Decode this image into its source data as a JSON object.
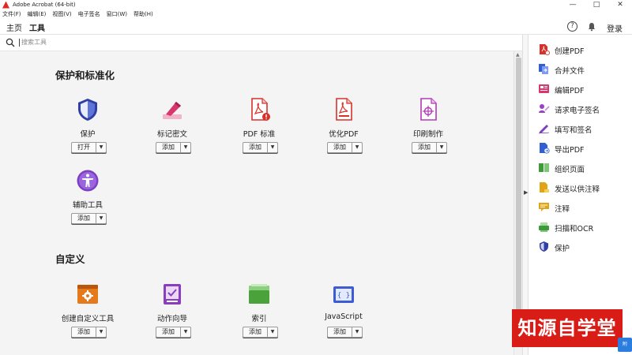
{
  "window": {
    "title": "Adobe Acrobat (64-bit)",
    "controls": [
      "—",
      "□",
      "✕"
    ]
  },
  "menu": [
    "文件(F)",
    "编辑(E)",
    "视图(V)",
    "电子签名",
    "窗口(W)",
    "帮助(H)"
  ],
  "topbar": {
    "tabs": [
      "主页",
      "工具"
    ],
    "active_tab": "工具",
    "help_icon": "?",
    "login": "登录"
  },
  "search": {
    "placeholder": "搜索工具"
  },
  "sections": [
    {
      "title": "保护和标准化",
      "tools": [
        {
          "label": "保护",
          "button": "打开",
          "icon": "shield-icon",
          "color": "#2f3fa3"
        },
        {
          "label": "标记密文",
          "button": "添加",
          "icon": "redact-icon",
          "color": "#d6386e"
        },
        {
          "label": "PDF 标准",
          "button": "添加",
          "icon": "pdf-standard-icon",
          "color": "#d9302a"
        },
        {
          "label": "优化PDF",
          "button": "添加",
          "icon": "optimize-pdf-icon",
          "color": "#d9302a"
        },
        {
          "label": "印刷制作",
          "button": "添加",
          "icon": "print-production-icon",
          "color": "#b23ab5"
        },
        {
          "label": "辅助工具",
          "button": "添加",
          "icon": "accessibility-icon",
          "color": "#7b3fc4"
        }
      ]
    },
    {
      "title": "自定义",
      "tools": [
        {
          "label": "创建自定义工具",
          "button": "添加",
          "icon": "custom-tool-icon",
          "color": "#e57a1c"
        },
        {
          "label": "动作向导",
          "button": "添加",
          "icon": "action-wizard-icon",
          "color": "#8a3ebf"
        },
        {
          "label": "索引",
          "button": "添加",
          "icon": "index-icon",
          "color": "#4aa33a"
        },
        {
          "label": "JavaScript",
          "button": "添加",
          "icon": "javascript-icon",
          "color": "#3d5bd6"
        }
      ]
    }
  ],
  "right_panel": [
    {
      "label": "创建PDF",
      "icon": "create-pdf-icon",
      "color": "#d9302a"
    },
    {
      "label": "合并文件",
      "icon": "combine-files-icon",
      "color": "#2f5fd0"
    },
    {
      "label": "编辑PDF",
      "icon": "edit-pdf-icon",
      "color": "#d6386e"
    },
    {
      "label": "请求电子签名",
      "icon": "request-sign-icon",
      "color": "#9a3ec4"
    },
    {
      "label": "填写和签名",
      "icon": "fill-sign-icon",
      "color": "#7b3fc4"
    },
    {
      "label": "导出PDF",
      "icon": "export-pdf-icon",
      "color": "#2f5fd0"
    },
    {
      "label": "组织页面",
      "icon": "organize-pages-icon",
      "color": "#3f9a3a"
    },
    {
      "label": "发送以供注释",
      "icon": "send-comment-icon",
      "color": "#e0a417"
    },
    {
      "label": "注释",
      "icon": "comment-icon",
      "color": "#e0a417"
    },
    {
      "label": "扫描和OCR",
      "icon": "scan-ocr-icon",
      "color": "#3f9a3a"
    },
    {
      "label": "保护",
      "icon": "protect-icon",
      "color": "#2f3fa3"
    }
  ],
  "watermark": "知源自学堂",
  "corner_tab": "附"
}
